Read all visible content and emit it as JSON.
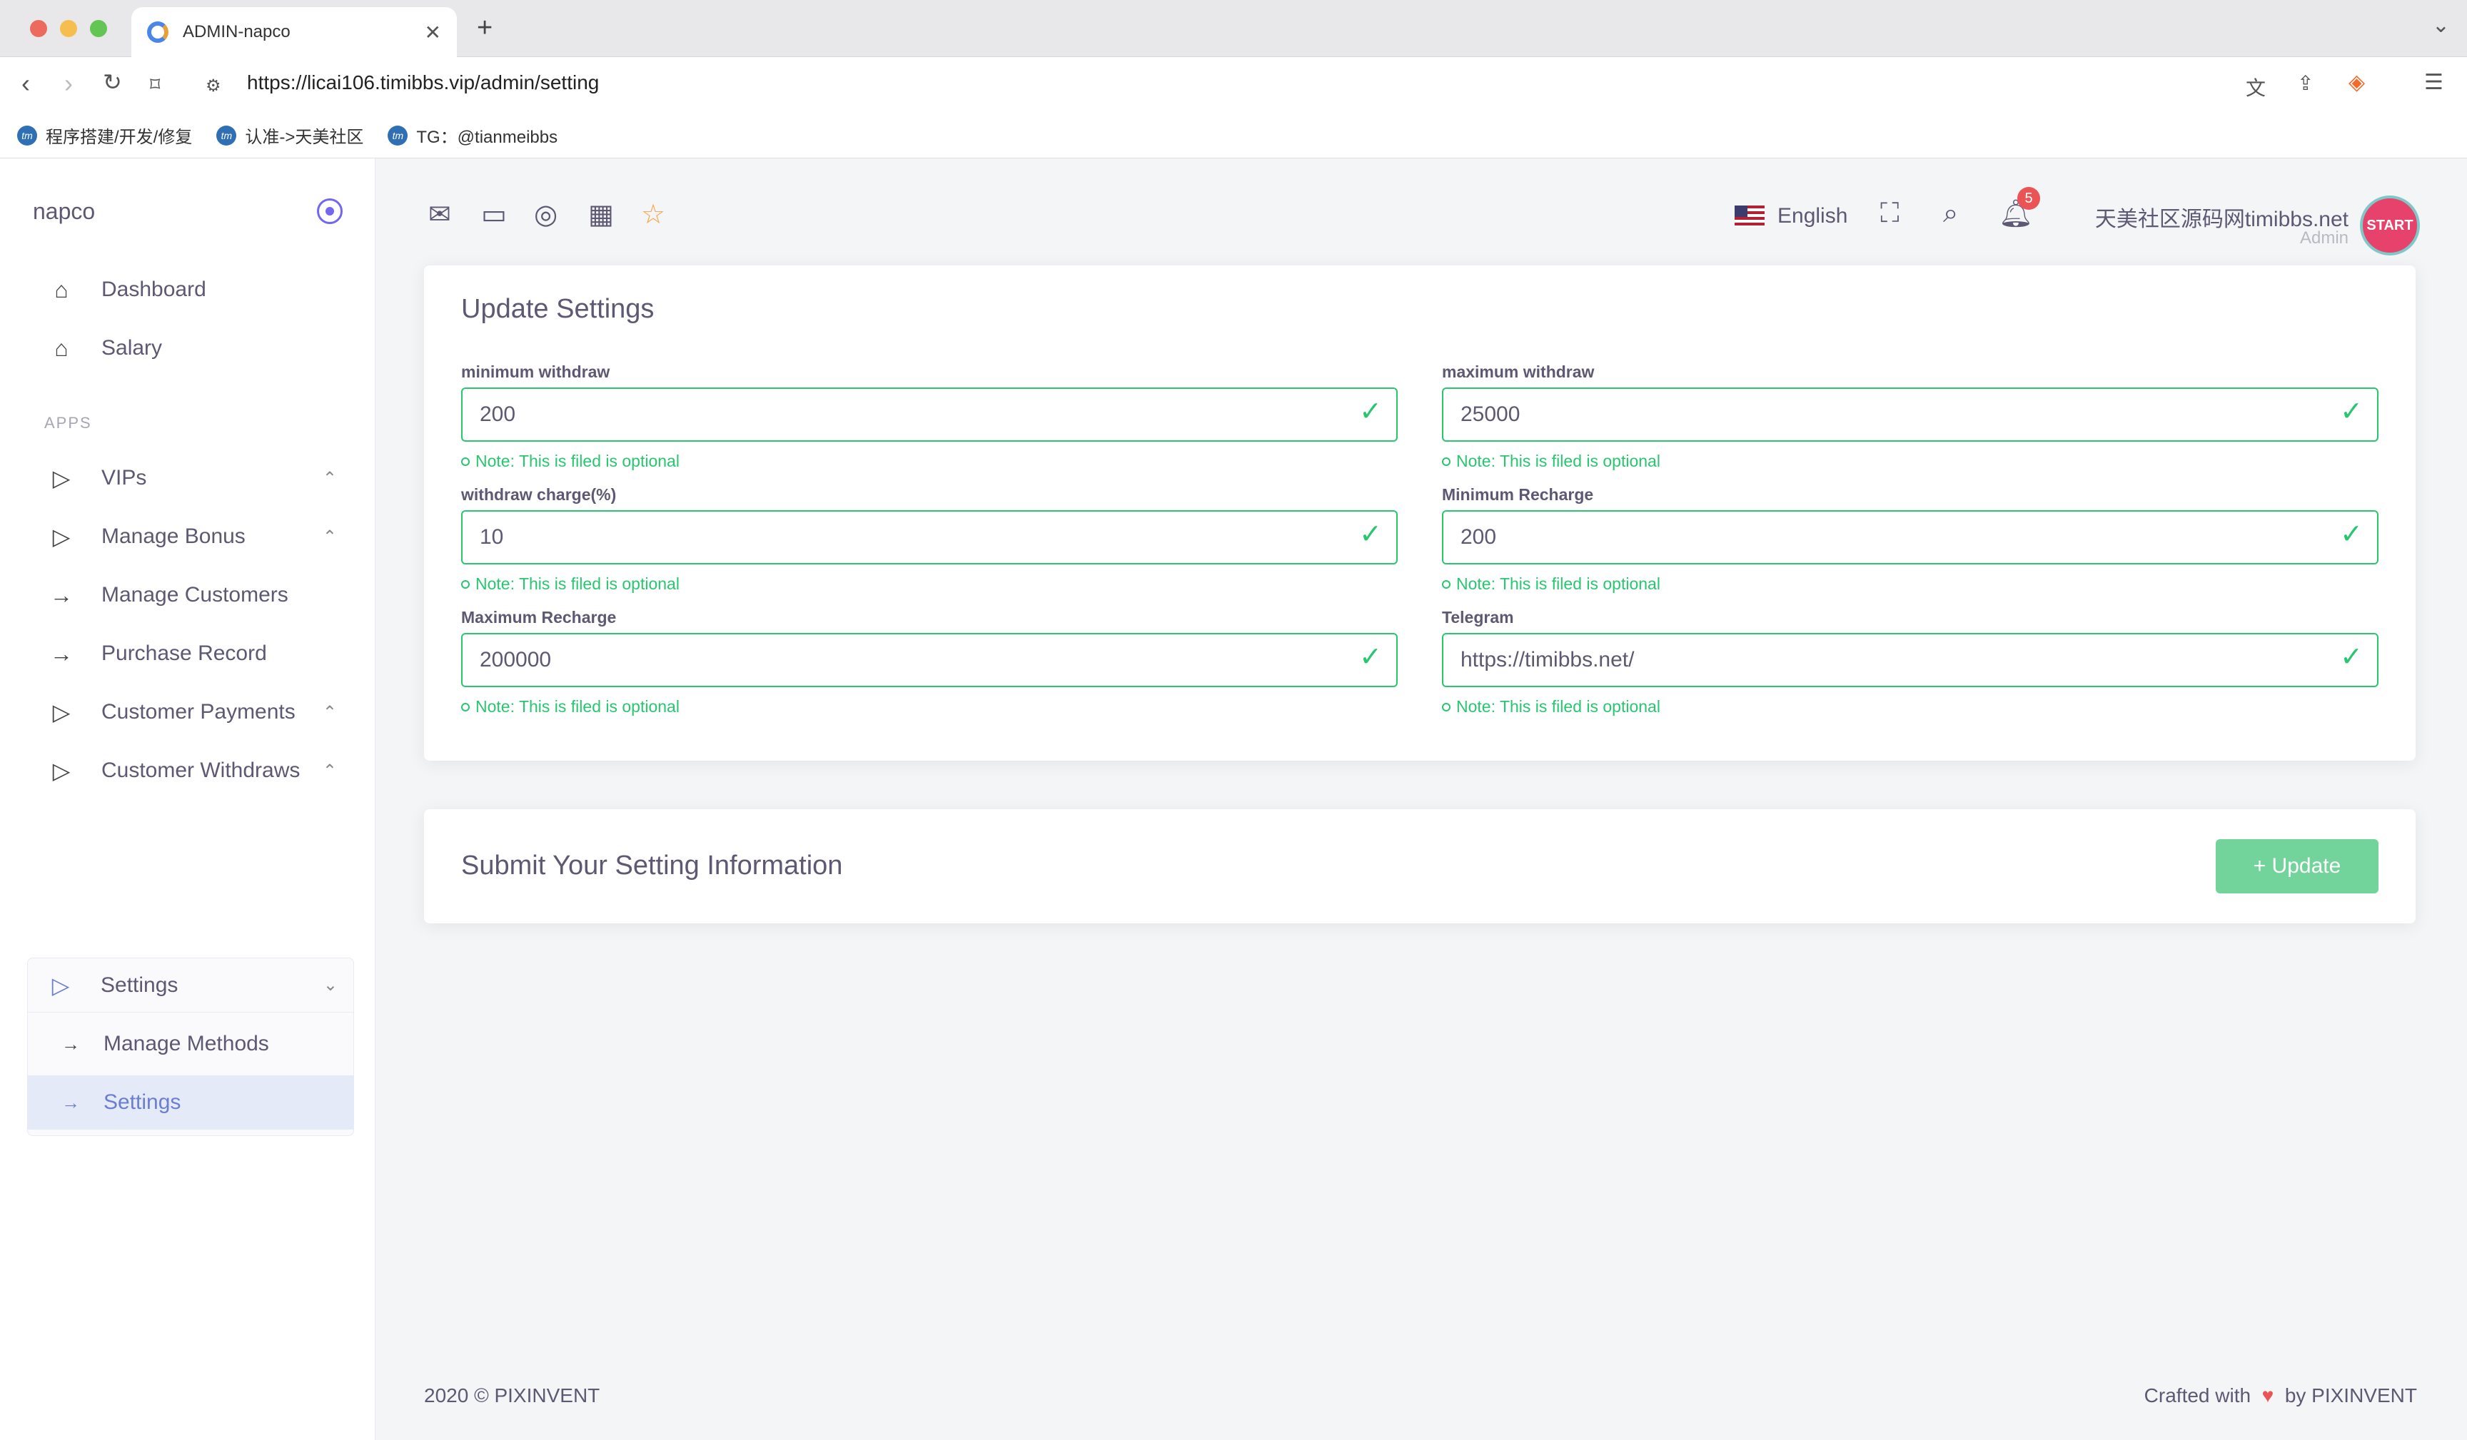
{
  "browser": {
    "tab_title": "ADMIN-napco",
    "url": "https://licai106.timibbs.vip/admin/setting",
    "bookmarks": [
      {
        "label": "程序搭建/开发/修复"
      },
      {
        "label": "认准->天美社区"
      },
      {
        "label": "TG：@tianmeibbs"
      }
    ]
  },
  "sidebar": {
    "brand": "napco",
    "items": [
      {
        "label": "Dashboard",
        "icon": "home-icon"
      },
      {
        "label": "Salary",
        "icon": "home-icon"
      }
    ],
    "apps_header": "APPS",
    "apps": [
      {
        "label": "VIPs",
        "icon": "play-icon"
      },
      {
        "label": "Manage Bonus",
        "icon": "play-icon"
      },
      {
        "label": "Manage Customers",
        "icon": "arrow-right-icon"
      },
      {
        "label": "Purchase Record",
        "icon": "arrow-right-icon"
      },
      {
        "label": "Customer Payments",
        "icon": "play-icon"
      },
      {
        "label": "Customer Withdraws",
        "icon": "play-icon"
      },
      {
        "label": "Settings",
        "icon": "play-icon"
      }
    ],
    "settings_sub": [
      {
        "label": "Manage Methods"
      },
      {
        "label": "Settings"
      }
    ]
  },
  "topbar": {
    "language": "English",
    "notifications_count": "5",
    "user_name": "天美社区源码网timibbs.net",
    "user_role": "Admin",
    "avatar_text": "START"
  },
  "settings_form": {
    "title": "Update Settings",
    "note": "Note: This is filed is optional",
    "fields": [
      {
        "label": "minimum withdraw",
        "value": "200"
      },
      {
        "label": "maximum withdraw",
        "value": "25000"
      },
      {
        "label": "withdraw charge(%)",
        "value": "10"
      },
      {
        "label": "Minimum Recharge",
        "value": "200"
      },
      {
        "label": "Maximum Recharge",
        "value": "200000"
      },
      {
        "label": "Telegram",
        "value": "https://timibbs.net/"
      }
    ]
  },
  "submit": {
    "title": "Submit Your Setting Information",
    "button": "+ Update"
  },
  "footer": {
    "left": "2020 © PIXINVENT",
    "right_prefix": "Crafted with",
    "right_suffix": "by PIXINVENT"
  },
  "colors": {
    "accent": "#7367f0",
    "success": "#28c76f",
    "danger": "#ea5455"
  }
}
